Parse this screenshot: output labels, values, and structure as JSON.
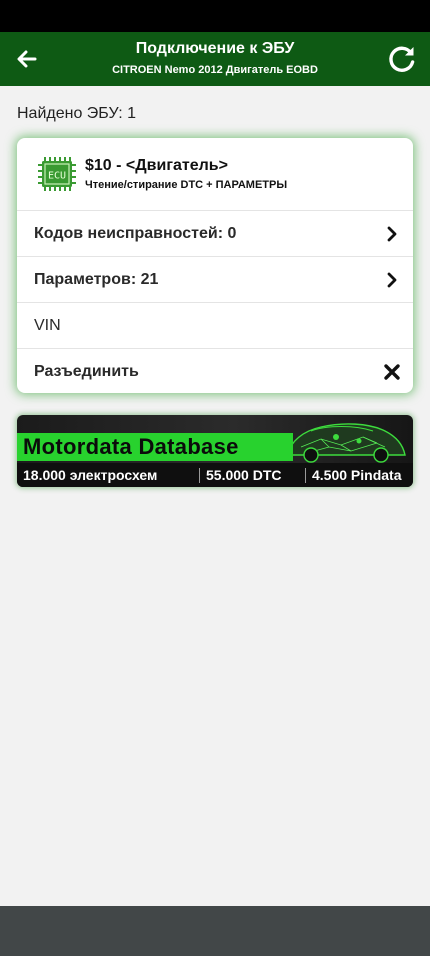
{
  "header": {
    "title": "Подключение к ЭБУ",
    "subtitle": "CITROEN Nemo 2012 Двигатель EOBD",
    "back_icon": "arrow-left-icon",
    "refresh_icon": "refresh-icon"
  },
  "found_label": "Найдено ЭБУ: 1",
  "ecu_card": {
    "icon": "ecu-chip-icon",
    "title": "$10 - <Двигатель>",
    "description": "Чтение/стирание DTC + ПАРАМЕТРЫ",
    "rows": [
      {
        "label": "Кодов неисправностей: 0",
        "icon": "chevron-right-icon"
      },
      {
        "label": "Параметров: 21",
        "icon": "chevron-right-icon"
      },
      {
        "label": "VIN"
      },
      {
        "label": "Разъединить",
        "icon": "close-icon"
      }
    ]
  },
  "banner": {
    "title": "Motordata Database",
    "stats": [
      "18.000 электросхем",
      "55.000 DTC",
      "4.500 Pindata"
    ]
  },
  "colors": {
    "header_bg": "#0e5a14",
    "card_glow": "#2aa02a",
    "banner_accent": "#28d22e",
    "page_bg": "#f2f2f2",
    "nav_bar": "#424748"
  }
}
